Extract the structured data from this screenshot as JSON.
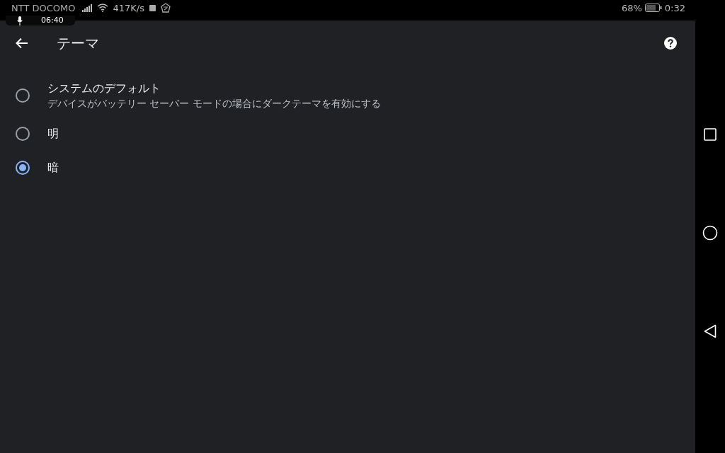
{
  "status_bar": {
    "carrier": "NTT DOCOMO",
    "recording_time": "06:40",
    "speed": "417K/s",
    "battery": "68%",
    "time": "0:32"
  },
  "toolbar": {
    "title": "テーマ"
  },
  "options": [
    {
      "label": "システムのデフォルト",
      "description": "デバイスがバッテリー セーバー モードの場合にダークテーマを有効にする",
      "selected": false
    },
    {
      "label": "明",
      "selected": false
    },
    {
      "label": "暗",
      "selected": true
    }
  ]
}
